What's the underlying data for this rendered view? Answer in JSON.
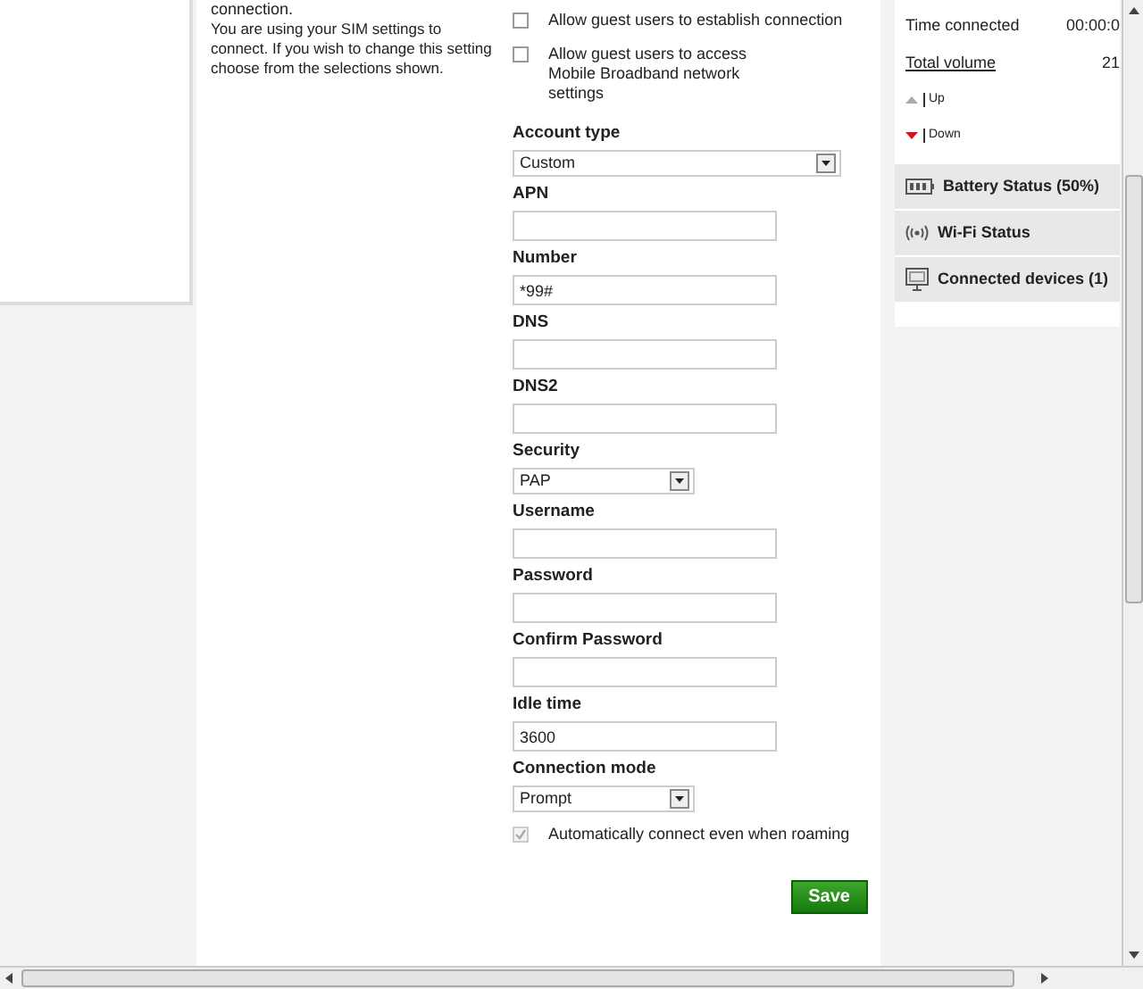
{
  "intro": {
    "cut_line": "connection.",
    "text": "You are using your SIM settings to connect. If you wish to change this setting choose from the selections shown."
  },
  "form": [
    {
      "kind": "checkbox",
      "label": "Allow guest users to establish connection",
      "checked": false,
      "disabled": false
    },
    {
      "kind": "checkbox",
      "label": "Allow guest users to access Mobile Broadband network settings",
      "checked": false,
      "disabled": false
    },
    {
      "kind": "select",
      "label": "Account type",
      "value": "Custom",
      "wide": true
    },
    {
      "kind": "input",
      "label": "APN"
    },
    {
      "kind": "input",
      "label": "Number",
      "value": "*99#"
    },
    {
      "kind": "input",
      "label": "DNS"
    },
    {
      "kind": "input",
      "label": "DNS2"
    },
    {
      "kind": "select",
      "label": "Security",
      "value": "PAP",
      "wide": false
    },
    {
      "kind": "input",
      "label": "Username"
    },
    {
      "kind": "input",
      "label": "Password"
    },
    {
      "kind": "input",
      "label": "Confirm Password"
    },
    {
      "kind": "input",
      "label": "Idle time",
      "value": "3600"
    },
    {
      "kind": "select",
      "label": "Connection mode",
      "value": "Prompt",
      "wide": false
    },
    {
      "kind": "checkbox",
      "label": "Automatically connect even when roaming",
      "checked": true,
      "disabled": true
    }
  ],
  "save_button": "Save",
  "stats": [
    {
      "label": "Time connected",
      "value": "00:00:0",
      "link": false
    },
    {
      "label": "Total volume",
      "value": "21",
      "link": true
    }
  ],
  "legend": [
    {
      "kind": "up",
      "label": "Up"
    },
    {
      "kind": "down",
      "label": "Down"
    }
  ],
  "panels": [
    {
      "kind": "battery",
      "label": "Battery Status (50%)"
    },
    {
      "kind": "wifi",
      "label": "Wi-Fi Status"
    },
    {
      "kind": "devices",
      "label": "Connected devices (1)"
    }
  ]
}
